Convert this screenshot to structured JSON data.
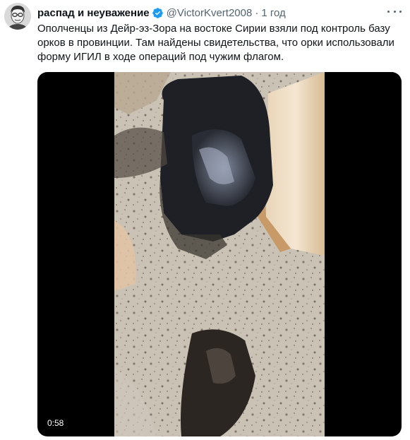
{
  "tweet": {
    "author": {
      "display_name": "распад и неуважение",
      "handle": "@VictorKvert2008",
      "verified": true
    },
    "separator": "·",
    "timestamp": "1 год",
    "text": "Ополченцы из Дейр-эз-Зора на востоке Сирии взяли под контроль базу орков в провинции. Там найдены свидетельства, что орки использовали форму ИГИЛ в ходе операций под чужим флагом.",
    "media": {
      "type": "video",
      "duration": "0:58"
    }
  },
  "colors": {
    "text_primary": "#0f1419",
    "text_secondary": "#536471",
    "verified_blue": "#1d9bf0",
    "media_background": "#000000"
  },
  "icons": {
    "verified": "verified-badge-icon",
    "more": "more-options-icon"
  }
}
